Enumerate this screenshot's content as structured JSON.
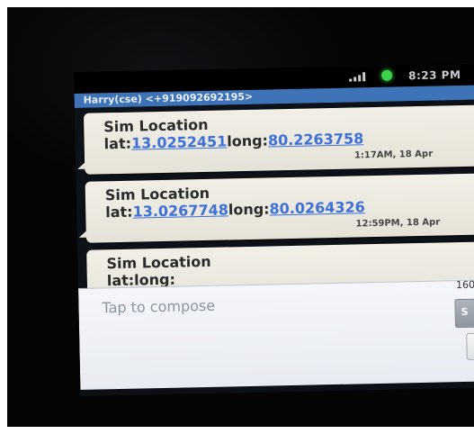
{
  "status_bar": {
    "time": "8:23 PM"
  },
  "header": {
    "contact": "Harry(cse) <+919092692195>"
  },
  "messages": [
    {
      "title": "Sim Location",
      "lat_label": "lat:",
      "lat": "13.0252451",
      "long_label": "long:",
      "long": "80.2263758",
      "time": "1:17AM, 18 Apr"
    },
    {
      "title": "Sim Location",
      "lat_label": "lat:",
      "lat": "13.0267748",
      "long_label": "long:",
      "long": "80.0264326",
      "time": "12:59PM, 18 Apr"
    },
    {
      "title": "Sim Location",
      "lat_label": "lat:",
      "lat": "",
      "long_label": "long:",
      "long": "",
      "time": ""
    }
  ],
  "composer": {
    "placeholder": "Tap to compose",
    "char_count": "160",
    "send_label": "S"
  },
  "colors": {
    "title_bar": "#3f73b8",
    "bubble": "#eeebe2",
    "link": "#3e71d8",
    "composer": "#eef0f5"
  }
}
